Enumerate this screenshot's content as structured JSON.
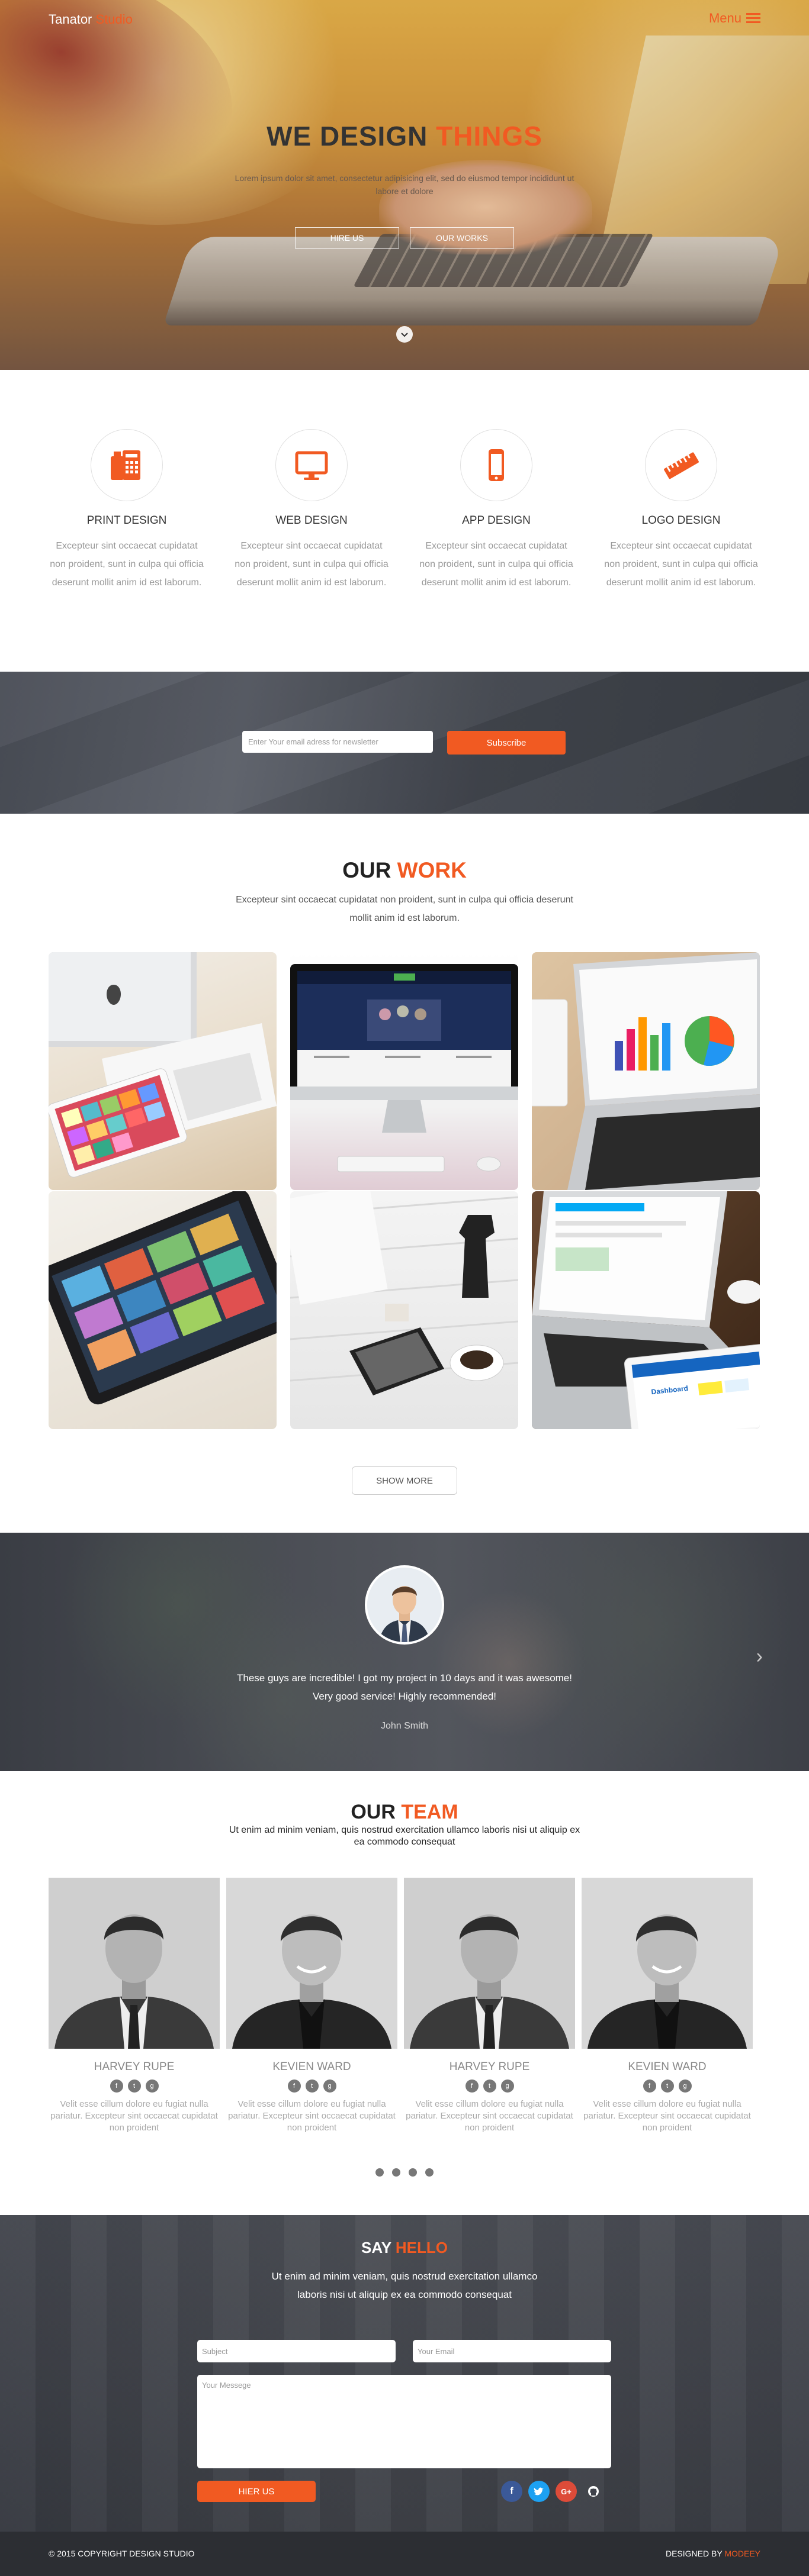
{
  "brand": {
    "first": "Tanator",
    "second": "Studio"
  },
  "nav": {
    "menu_label": "Menu"
  },
  "hero": {
    "title_main": "WE DESIGN",
    "title_accent": "THINGS",
    "subtitle": "Lorem ipsum dolor sit amet, consectetur adipisicing elit, sed do eiusmod tempor incididunt ut labore et dolore",
    "buttons": [
      "HIRE US",
      "OUR WORKS"
    ]
  },
  "services": [
    {
      "icon": "print-icon",
      "title": "PRINT DESIGN",
      "text": "Excepteur sint occaecat cupidatat non proident, sunt in culpa qui officia deserunt mollit anim id est laborum."
    },
    {
      "icon": "monitor-icon",
      "title": "WEB DESIGN",
      "text": "Excepteur sint occaecat cupidatat non proident, sunt in culpa qui officia deserunt mollit anim id est laborum."
    },
    {
      "icon": "phone-icon",
      "title": "APP DESIGN",
      "text": "Excepteur sint occaecat cupidatat non proident, sunt in culpa qui officia deserunt mollit anim id est laborum."
    },
    {
      "icon": "ruler-icon",
      "title": "LOGO DESIGN",
      "text": "Excepteur sint occaecat cupidatat non proident, sunt in culpa qui officia deserunt mollit anim id est laborum."
    }
  ],
  "newsletter": {
    "placeholder": "Enter Your email adress for newsletter",
    "button": "Subscribe"
  },
  "work": {
    "title_main": "OUR",
    "title_accent": "WORK",
    "description": "Excepteur sint occaecat cupidatat non proident, sunt in culpa qui officia deserunt mollit anim id est laborum.",
    "show_more": "SHOW MORE"
  },
  "testimonial": {
    "quote_line1": "These guys are incredible! I got my project in 10 days and it was awesome!",
    "quote_line2": "Very good service! Highly recommended!",
    "name": "John Smith"
  },
  "team": {
    "title_main": "OUR",
    "title_accent": "TEAM",
    "subtitle": "Ut enim ad minim veniam, quis nostrud exercitation ullamco laboris nisi ut aliquip ex ea commodo consequat",
    "members": [
      {
        "name": "HARVEY RUPE",
        "text": "Velit esse cillum dolore eu fugiat nulla pariatur. Excepteur sint occaecat cupidatat non proident"
      },
      {
        "name": "KEVIEN WARD",
        "text": "Velit esse cillum dolore eu fugiat nulla pariatur. Excepteur sint occaecat cupidatat non proident"
      },
      {
        "name": "HARVEY RUPE",
        "text": "Velit esse cillum dolore eu fugiat nulla pariatur. Excepteur sint occaecat cupidatat non proident"
      },
      {
        "name": "KEVIEN WARD",
        "text": "Velit esse cillum dolore eu fugiat nulla pariatur. Excepteur sint occaecat cupidatat non proident"
      }
    ]
  },
  "contact": {
    "title_main": "SAY",
    "title_accent": "HELLO",
    "subtitle_line1": "Ut enim ad minim veniam, quis nostrud exercitation ullamco",
    "subtitle_line2": "laboris nisi ut aliquip ex ea commodo consequat",
    "subject_placeholder": "Subject",
    "email_placeholder": "Your Email",
    "message_placeholder": "Your Messege",
    "send_button": "HIER US"
  },
  "footer": {
    "copyright": "© 2015 COPYRIGHT DESIGN STUDIO",
    "designed_by": "DESIGNED BY",
    "designer": "MODEEY"
  },
  "colors": {
    "accent": "#f15a22",
    "dark": "#3b3e46",
    "text": "#333333",
    "muted": "#999999"
  }
}
